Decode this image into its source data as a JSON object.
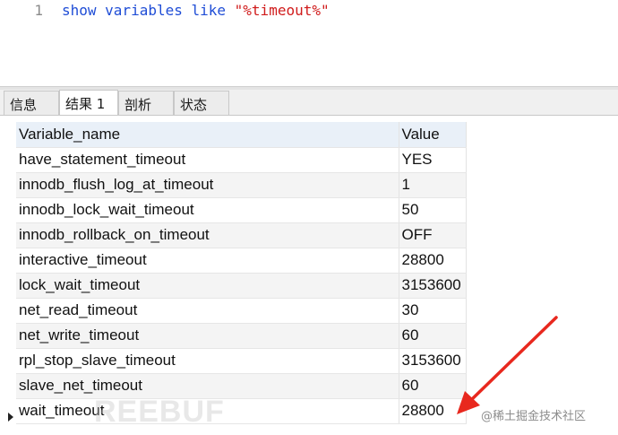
{
  "editor": {
    "line_number": "1",
    "query_keywords": "show variables like ",
    "query_pattern": "\"%timeout%\""
  },
  "tabs": [
    {
      "label": "信息",
      "active": false
    },
    {
      "label": "结果 1",
      "active": true
    },
    {
      "label": "剖析",
      "active": false
    },
    {
      "label": "状态",
      "active": false
    }
  ],
  "grid": {
    "columns": [
      "Variable_name",
      "Value"
    ],
    "rows": [
      [
        "have_statement_timeout",
        "YES"
      ],
      [
        "innodb_flush_log_at_timeout",
        "1"
      ],
      [
        "innodb_lock_wait_timeout",
        "50"
      ],
      [
        "innodb_rollback_on_timeout",
        "OFF"
      ],
      [
        "interactive_timeout",
        "28800"
      ],
      [
        "lock_wait_timeout",
        "3153600"
      ],
      [
        "net_read_timeout",
        "30"
      ],
      [
        "net_write_timeout",
        "60"
      ],
      [
        "rpl_stop_slave_timeout",
        "3153600"
      ],
      [
        "slave_net_timeout",
        "60"
      ],
      [
        "wait_timeout",
        "28800"
      ]
    ],
    "selected_row": 10
  },
  "annotations": {
    "watermark": "REEBUF",
    "credit": "@稀土掘金技术社区",
    "arrow_color": "#e8281e"
  },
  "colors": {
    "keyword": "#1f4dd6",
    "string": "#d01b1b",
    "header_bg": "#e9f0f8",
    "alt_row_bg": "#f4f4f4"
  }
}
